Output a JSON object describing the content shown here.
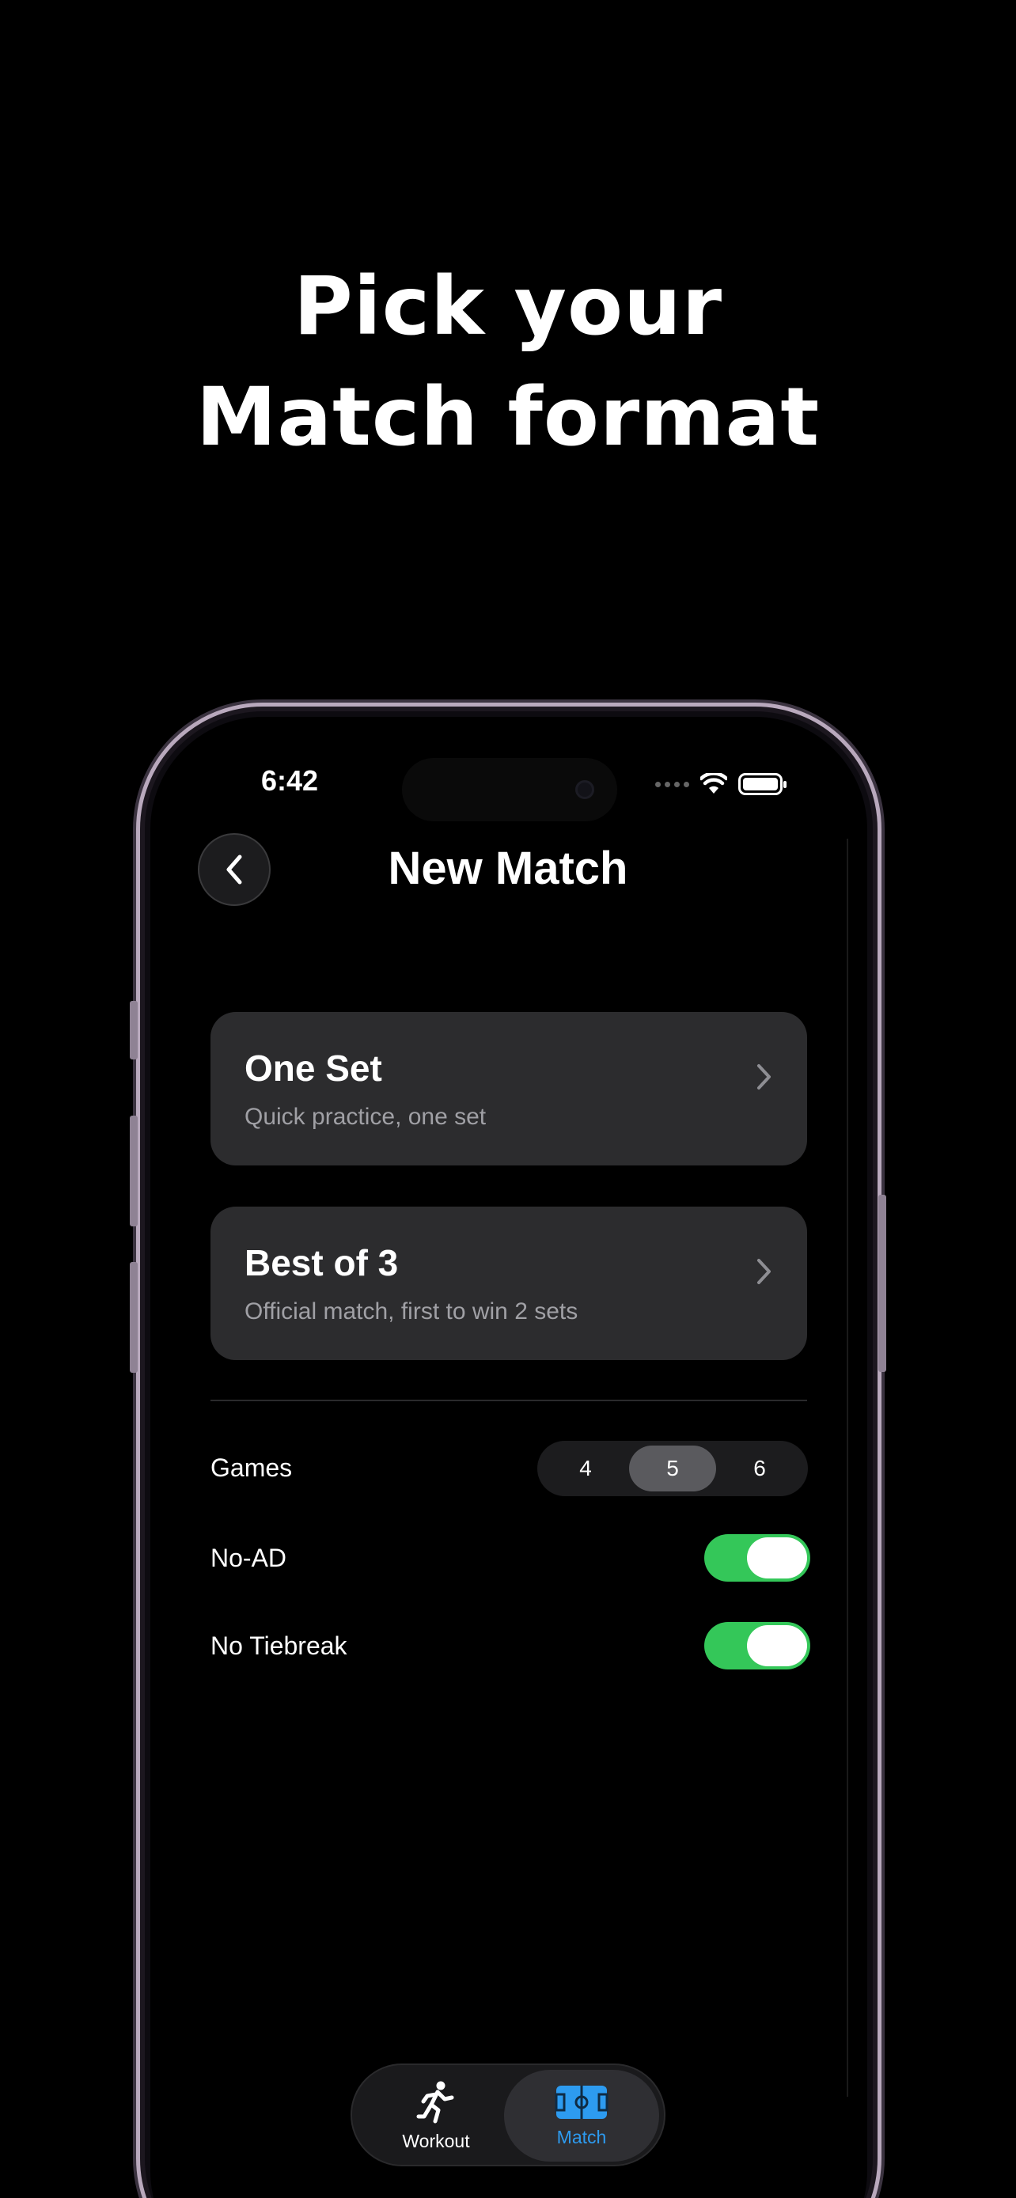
{
  "headline": {
    "line1": "Pick your",
    "line2": "Match format"
  },
  "status_bar": {
    "time": "6:42"
  },
  "nav": {
    "title": "New Match",
    "back_icon": "chevron-left-icon"
  },
  "cards": [
    {
      "title": "One Set",
      "subtitle": "Quick practice, one set",
      "icon": "chevron-right-icon"
    },
    {
      "title": "Best of 3",
      "subtitle": "Official match, first to win 2 sets",
      "icon": "chevron-right-icon"
    }
  ],
  "settings": {
    "games": {
      "label": "Games",
      "options": [
        "4",
        "5",
        "6"
      ],
      "selected": "5"
    },
    "no_ad": {
      "label": "No-AD",
      "on": true
    },
    "no_tiebreak": {
      "label": "No Tiebreak",
      "on": true
    }
  },
  "tabs": [
    {
      "label": "Workout",
      "icon": "running-figure-icon",
      "active": false
    },
    {
      "label": "Match",
      "icon": "tennis-court-icon",
      "active": true
    }
  ],
  "colors": {
    "toggle_on": "#34c759",
    "active_tab": "#2d9bf0",
    "card_bg": "#2c2c2e"
  }
}
